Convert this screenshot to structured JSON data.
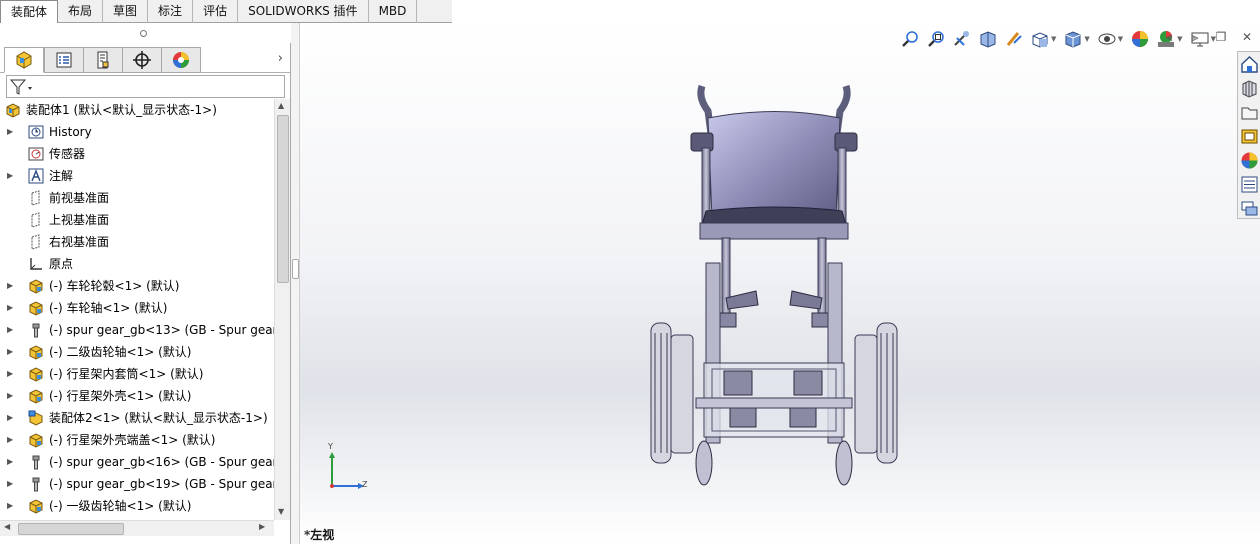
{
  "tabs": [
    {
      "label": "装配体",
      "active": true
    },
    {
      "label": "布局",
      "active": false
    },
    {
      "label": "草图",
      "active": false
    },
    {
      "label": "标注",
      "active": false
    },
    {
      "label": "评估",
      "active": false
    },
    {
      "label": "SOLIDWORKS 插件",
      "active": false
    },
    {
      "label": "MBD",
      "active": false
    }
  ],
  "panel_tabs": [
    "feature-manager-icon",
    "property-manager-icon",
    "configuration-manager-icon",
    "dimxpert-icon",
    "display-manager-icon"
  ],
  "tree": {
    "root": "装配体1  (默认<默认_显示状态-1>)",
    "items": [
      {
        "label": "History",
        "icon": "history-icon",
        "expandable": true
      },
      {
        "label": "传感器",
        "icon": "sensor-icon",
        "expandable": false
      },
      {
        "label": "注解",
        "icon": "annotation-icon",
        "expandable": true
      },
      {
        "label": "前视基准面",
        "icon": "plane-icon",
        "expandable": false
      },
      {
        "label": "上视基准面",
        "icon": "plane-icon",
        "expandable": false
      },
      {
        "label": "右视基准面",
        "icon": "plane-icon",
        "expandable": false
      },
      {
        "label": "原点",
        "icon": "origin-icon",
        "expandable": false
      },
      {
        "label": "(-) 车轮轮毂<1> (默认)",
        "icon": "part-icon",
        "expandable": true
      },
      {
        "label": "(-) 车轮轴<1> (默认)",
        "icon": "part-icon",
        "expandable": true
      },
      {
        "label": "(-) spur gear_gb<13> (GB - Spur gear",
        "icon": "toolbox-part-icon",
        "expandable": true
      },
      {
        "label": "(-) 二级齿轮轴<1> (默认)",
        "icon": "part-icon",
        "expandable": true
      },
      {
        "label": "(-) 行星架内套筒<1> (默认)",
        "icon": "part-icon",
        "expandable": true
      },
      {
        "label": "(-) 行星架外壳<1> (默认)",
        "icon": "part-icon",
        "expandable": true
      },
      {
        "label": "装配体2<1> (默认<默认_显示状态-1>)",
        "icon": "subassembly-icon",
        "expandable": true
      },
      {
        "label": "(-) 行星架外壳端盖<1> (默认)",
        "icon": "part-icon",
        "expandable": true
      },
      {
        "label": "(-) spur gear_gb<16> (GB - Spur gear",
        "icon": "toolbox-part-icon",
        "expandable": true
      },
      {
        "label": "(-) spur gear_gb<19> (GB - Spur gear",
        "icon": "toolbox-part-icon",
        "expandable": true
      },
      {
        "label": "(-) 一级齿轮轴<1> (默认)",
        "icon": "part-icon",
        "expandable": true
      }
    ]
  },
  "heads_up_toolbar": [
    "zoom-to-fit-icon",
    "zoom-to-area-icon",
    "previous-view-icon",
    "section-view-icon",
    "dynamic-annotation-icon",
    "view-orientation-icon",
    "display-style-icon",
    "hide-show-items-icon",
    "edit-appearance-icon",
    "apply-scene-icon",
    "view-settings-icon"
  ],
  "viewport": {
    "view_label": "*左视",
    "triad_labels": {
      "y": "Y",
      "z": "Z"
    }
  },
  "task_pane": [
    "home-icon",
    "design-library-icon",
    "file-explorer-icon",
    "view-palette-icon",
    "appearances-icon",
    "custom-properties-icon",
    "forum-icon"
  ],
  "colors": {
    "accent": "#2f6fd6",
    "panel_border": "#a8a8a8",
    "tab_bg": "#f0f0f0"
  }
}
